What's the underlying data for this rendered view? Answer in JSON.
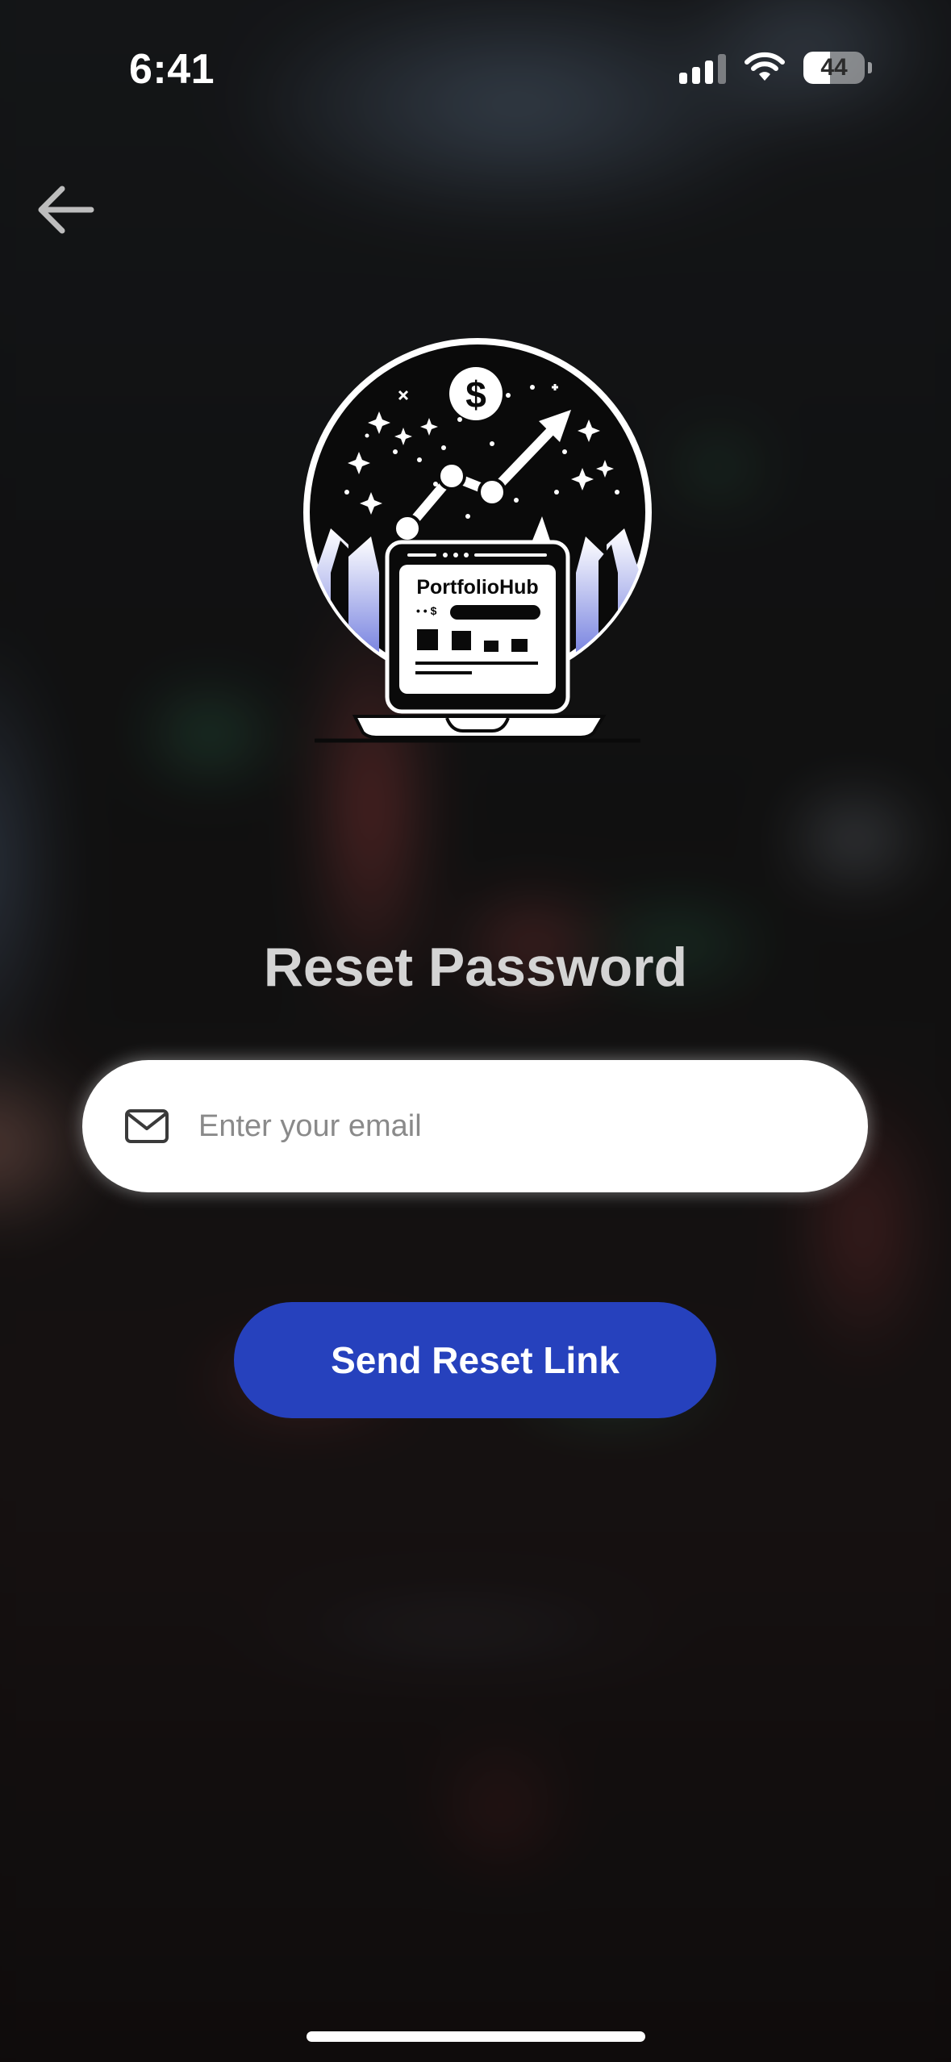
{
  "status_bar": {
    "time": "6:41",
    "battery_percent": "44",
    "battery_level": 0.44,
    "signal_bars": 3,
    "wifi": true
  },
  "navigation": {
    "back_icon": "arrow-left-icon"
  },
  "logo": {
    "brand_name": "PortfolioHub",
    "currency_symbol": "$",
    "dot_row_text": "• • $"
  },
  "form": {
    "title": "Reset Password",
    "email_placeholder": "Enter your email",
    "email_value": "",
    "email_icon": "envelope-icon",
    "submit_label": "Send Reset Link"
  },
  "colors": {
    "primary_button": "#2641bd",
    "title_text": "#d4d4d4",
    "logo_accent": "#6a74d8"
  }
}
